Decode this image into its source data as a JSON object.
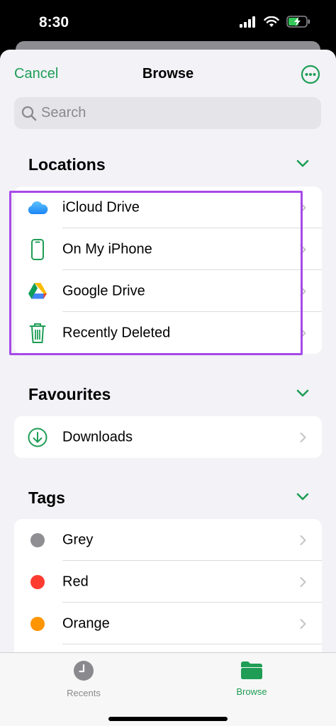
{
  "status_bar": {
    "time": "8:30"
  },
  "nav": {
    "cancel": "Cancel",
    "title": "Browse"
  },
  "search": {
    "placeholder": "Search"
  },
  "sections": {
    "locations": {
      "title": "Locations",
      "items": [
        {
          "label": "iCloud Drive",
          "icon": "icloud-icon"
        },
        {
          "label": "On My iPhone",
          "icon": "iphone-icon"
        },
        {
          "label": "Google Drive",
          "icon": "google-drive-icon"
        },
        {
          "label": "Recently Deleted",
          "icon": "trash-icon"
        }
      ]
    },
    "favourites": {
      "title": "Favourites",
      "items": [
        {
          "label": "Downloads",
          "icon": "download-icon"
        }
      ]
    },
    "tags": {
      "title": "Tags",
      "items": [
        {
          "label": "Grey",
          "color": "#8e8e93"
        },
        {
          "label": "Red",
          "color": "#ff3b30"
        },
        {
          "label": "Orange",
          "color": "#ff9500"
        }
      ]
    }
  },
  "tab_bar": {
    "tabs": [
      {
        "label": "Recents",
        "icon": "clock-icon",
        "active": false
      },
      {
        "label": "Browse",
        "icon": "folder-icon",
        "active": true
      }
    ]
  },
  "colors": {
    "accent": "#1f9d55",
    "highlight": "#a749e8",
    "inactive": "#8a8a8e"
  }
}
